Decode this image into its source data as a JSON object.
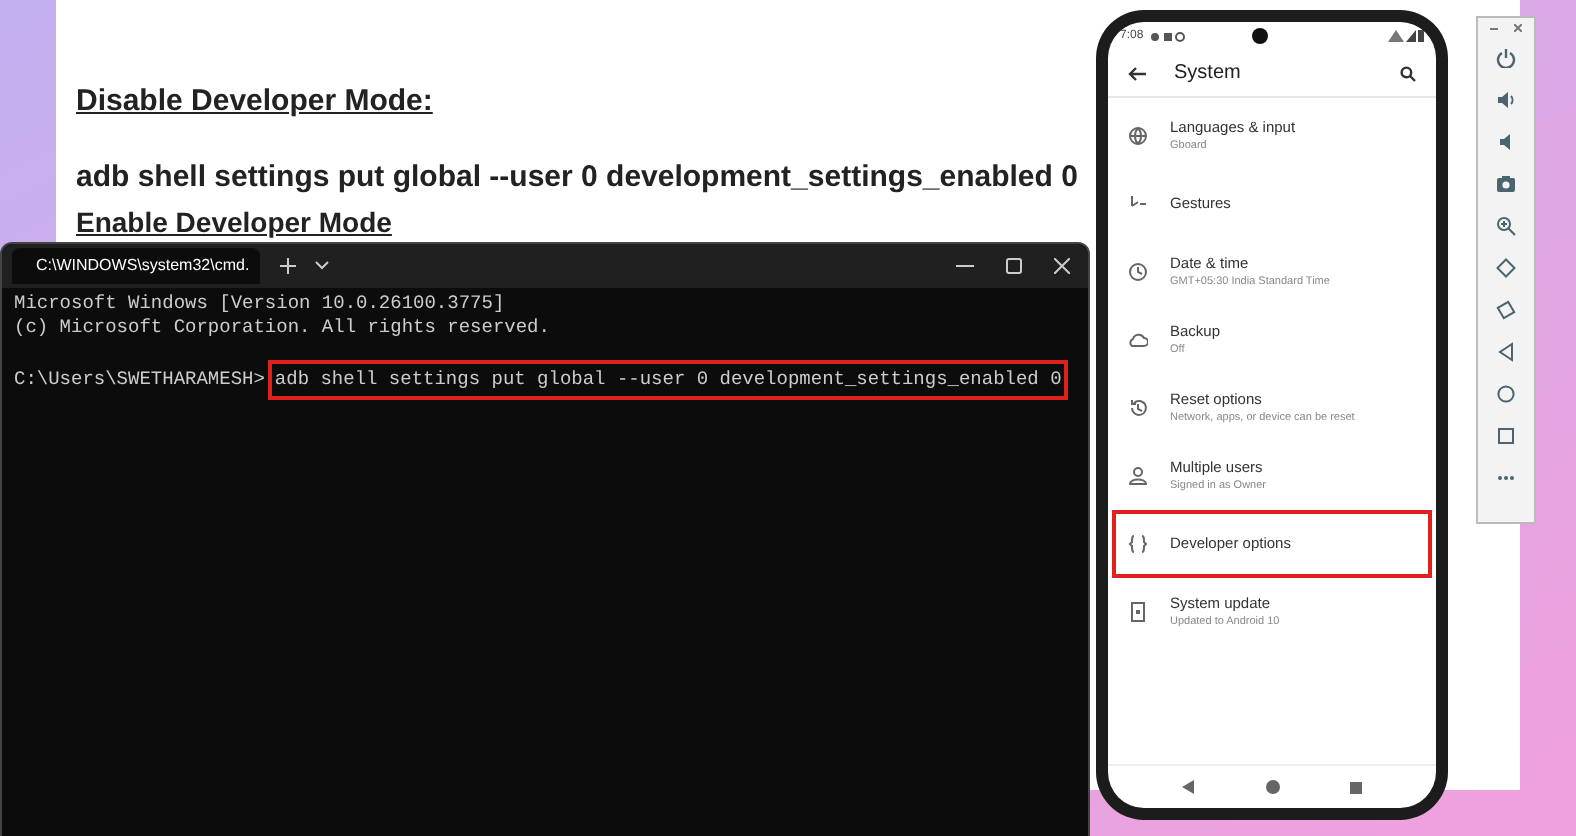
{
  "document": {
    "heading": "Disable Developer Mode:",
    "command": "adb shell settings put global --user 0 development_settings_enabled 0",
    "next_heading": "Enable Developer Mode"
  },
  "terminal": {
    "tab_title": "C:\\WINDOWS\\system32\\cmd.",
    "lines": [
      "Microsoft Windows [Version 10.0.26100.3775]",
      "(c) Microsoft Corporation. All rights reserved."
    ],
    "prompt": "C:\\Users\\SWETHARAMESH>",
    "command": "adb shell settings put global --user 0 development_settings_enabled 0",
    "command_highlighted": true
  },
  "phone": {
    "status_time": "7:08",
    "title": "System",
    "items": [
      {
        "title": "Languages & input",
        "subtitle": "Gboard",
        "highlighted": false
      },
      {
        "title": "Gestures",
        "highlighted": false
      },
      {
        "title": "Date & time",
        "subtitle": "GMT+05:30 India Standard Time",
        "highlighted": false
      },
      {
        "title": "Backup",
        "subtitle": "Off",
        "highlighted": false
      },
      {
        "title": "Reset options",
        "subtitle": "Network, apps, or device can be reset",
        "highlighted": false
      },
      {
        "title": "Multiple users",
        "subtitle": "Signed in as Owner",
        "highlighted": false
      },
      {
        "title": "Developer options",
        "highlighted": true
      },
      {
        "title": "System update",
        "subtitle": "Updated to Android 10",
        "highlighted": false
      }
    ]
  }
}
